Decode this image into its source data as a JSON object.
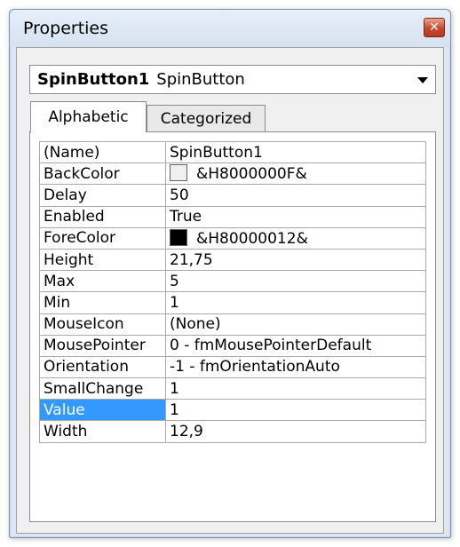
{
  "window": {
    "title": "Properties",
    "close_icon": "close-icon"
  },
  "object_selector": {
    "name": "SpinButton1",
    "type": "SpinButton"
  },
  "tabs": [
    {
      "label": "Alphabetic",
      "active": true
    },
    {
      "label": "Categorized",
      "active": false
    }
  ],
  "colors": {
    "backcolor_swatch": "#f0f0f0",
    "forecolor_swatch": "#000000",
    "selection": "#3399ff"
  },
  "properties": [
    {
      "name": "(Name)",
      "value": "SpinButton1"
    },
    {
      "name": "BackColor",
      "value": "&H8000000F&"
    },
    {
      "name": "Delay",
      "value": "50"
    },
    {
      "name": "Enabled",
      "value": "True"
    },
    {
      "name": "ForeColor",
      "value": "&H80000012&"
    },
    {
      "name": "Height",
      "value": "21,75"
    },
    {
      "name": "Max",
      "value": "5"
    },
    {
      "name": "Min",
      "value": "1"
    },
    {
      "name": "MouseIcon",
      "value": "(None)"
    },
    {
      "name": "MousePointer",
      "value": "0 - fmMousePointerDefault"
    },
    {
      "name": "Orientation",
      "value": "-1 - fmOrientationAuto"
    },
    {
      "name": "SmallChange",
      "value": "1"
    },
    {
      "name": "Value",
      "value": "1",
      "selected": true
    },
    {
      "name": "Width",
      "value": "12,9"
    }
  ]
}
